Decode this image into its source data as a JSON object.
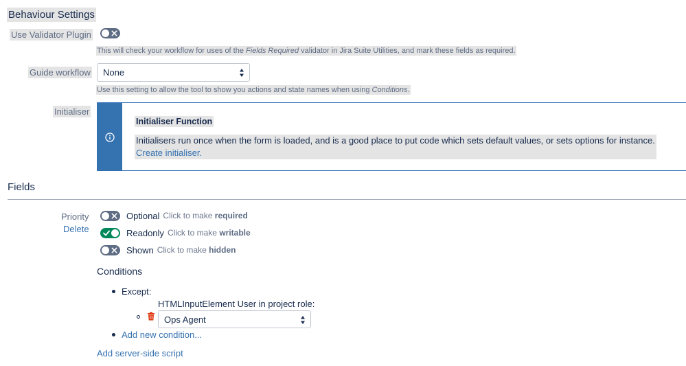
{
  "behaviour_settings": {
    "title": "Behaviour Settings",
    "validator": {
      "label": "Use Validator Plugin",
      "enabled": false,
      "desc_pre": "This will check your workflow for uses of the ",
      "desc_em": "Fields Required",
      "desc_post": " validator in Jira Suite Utilities, and mark these fields as required."
    },
    "guide": {
      "label": "Guide workflow",
      "selected": "None",
      "desc_pre": "Use this setting to allow the tool to show you actions and state names when using ",
      "desc_em": "Conditions",
      "desc_post": "."
    },
    "initialiser": {
      "label": "Initialiser",
      "panel_title": "Initialiser Function",
      "panel_text": "Initialisers run once when the form is loaded, and is a good place to put code which sets default values, or sets options for instance.",
      "link": "Create initialiser."
    }
  },
  "fields": {
    "title": "Fields",
    "field": {
      "name": "Priority",
      "delete": "Delete",
      "toggles": [
        {
          "state": "Optional",
          "hint": "Click to make",
          "target": "required",
          "on": false
        },
        {
          "state": "Readonly",
          "hint": "Click to make",
          "target": "writable",
          "on": true
        },
        {
          "state": "Shown",
          "hint": "Click to make",
          "target": "hidden",
          "on": false
        }
      ]
    },
    "conditions": {
      "title": "Conditions",
      "except": "Except:",
      "role_label": "HTMLInputElement User in project role:",
      "role_selected": "Ops Agent",
      "add_condition": "Add new condition..."
    },
    "add_script": "Add server-side script"
  },
  "colors": {
    "link": "#3572b0",
    "toggle_on": "#00875a",
    "toggle_off": "#5e6c84",
    "info_panel": "#3572b0",
    "delete_icon": "#de350b"
  }
}
